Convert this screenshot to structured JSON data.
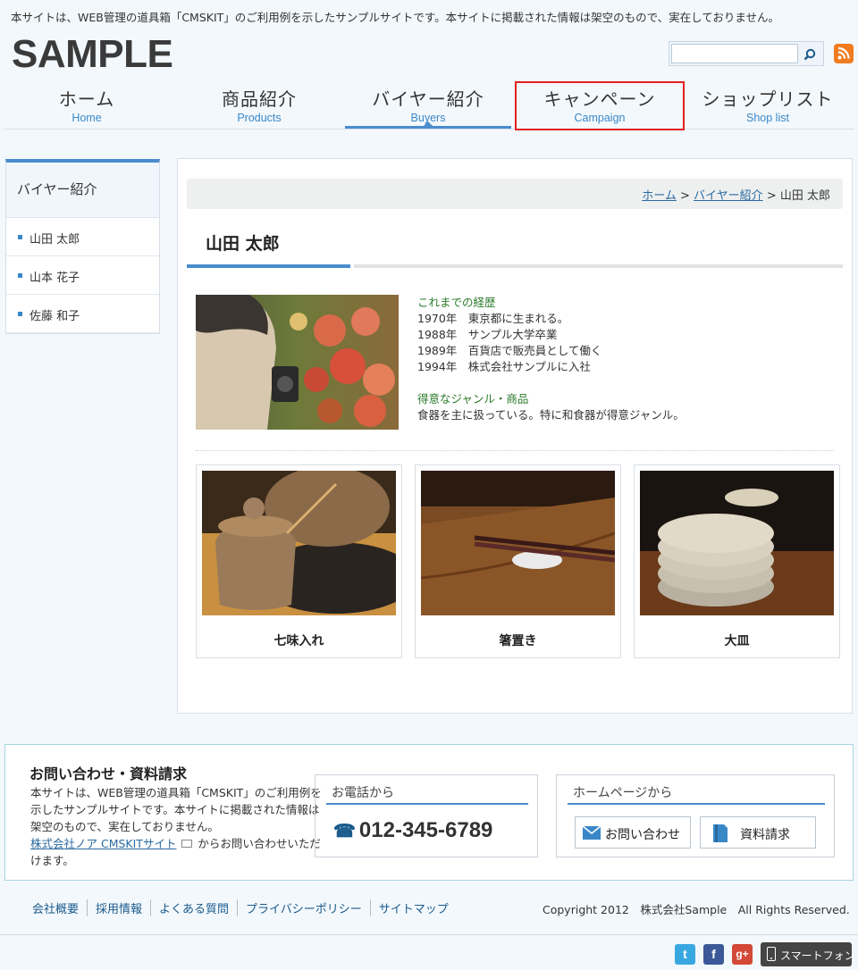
{
  "header": {
    "notice": "本サイトは、WEB管理の道具箱「CMSKIT」のご利用例を示したサンプルサイトです。本サイトに掲載された情報は架空のもので、実在しておりません。",
    "logo": "SAMPLE",
    "search_placeholder": ""
  },
  "nav": [
    {
      "jp": "ホーム",
      "en": "Home"
    },
    {
      "jp": "商品紹介",
      "en": "Products"
    },
    {
      "jp": "バイヤー紹介",
      "en": "Buyers"
    },
    {
      "jp": "キャンペーン",
      "en": "Campaign"
    },
    {
      "jp": "ショップリスト",
      "en": "Shop list"
    }
  ],
  "sidebar": {
    "title": "バイヤー紹介",
    "items": [
      "山田 太郎",
      "山本 花子",
      "佐藤 和子"
    ]
  },
  "breadcrumb": {
    "home": "ホーム",
    "sep": ">",
    "buyers": "バイヤー紹介",
    "current": "山田 太郎"
  },
  "profile": {
    "name": "山田 太郎",
    "career_heading": "これまでの経歴",
    "career": [
      "1970年　東京都に生まれる。",
      "1988年　サンプル大学卒業",
      "1989年　百貨店で販売員として働く",
      "1994年　株式会社サンプルに入社"
    ],
    "specialty_heading": "得意なジャンル・商品",
    "specialty": "食器を主に扱っている。特に和食器が得意ジャンル。"
  },
  "products": [
    {
      "name": "七味入れ"
    },
    {
      "name": "箸置き"
    },
    {
      "name": "大皿"
    }
  ],
  "contact": {
    "title": "お問い合わせ・資料請求",
    "text": "本サイトは、WEB管理の道具箱「CMSKIT」のご利用例を示したサンプルサイトです。本サイトに掲載された情報は架空のもので、実在しておりません。",
    "link": "株式会社ノア CMSKITサイト",
    "after_link": "からお問い合わせいただけます。",
    "phone_heading": "お電話から",
    "phone": "012-345-6789",
    "web_heading": "ホームページから",
    "inquiry_button": "お問い合わせ",
    "request_button": "資料請求"
  },
  "footer": {
    "links": [
      "会社概要",
      "採用情報",
      "よくある質問",
      "プライバシーポリシー",
      "サイトマップ"
    ],
    "copyright": "Copyright 2012　株式会社Sample　All Rights Reserved.",
    "smartphone": "スマートフォン"
  },
  "colors": {
    "accent": "#4a8ccc",
    "highlight": "#e02020",
    "background": "#f3f8fc"
  }
}
